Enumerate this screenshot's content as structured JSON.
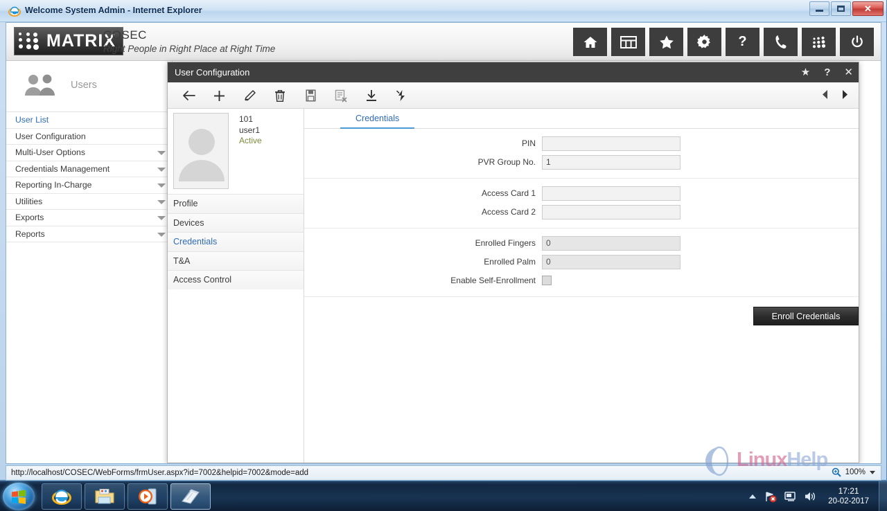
{
  "window": {
    "title": "Welcome System Admin - Internet Explorer",
    "favicon": "ie-icon",
    "minimize": "Minimize",
    "maximize": "Maximize",
    "close": "Close"
  },
  "app_header": {
    "brand": "MATRIX",
    "product": "COSEC",
    "tagline": "Right People in Right Place at Right Time",
    "icons": [
      {
        "name": "home-icon",
        "label": "Home"
      },
      {
        "name": "grid-icon",
        "label": "Dashboard"
      },
      {
        "name": "star-icon",
        "label": "Favorites"
      },
      {
        "name": "gear-icon",
        "label": "Settings"
      },
      {
        "name": "help-icon",
        "label": "Help"
      },
      {
        "name": "phone-icon",
        "label": "Support"
      },
      {
        "name": "dots-matrix-icon",
        "label": "Matrix"
      },
      {
        "name": "power-icon",
        "label": "Logout"
      }
    ]
  },
  "sidebar": {
    "section_title": "Users",
    "section_icon": "users-icon",
    "items": [
      {
        "label": "User List",
        "active": true,
        "expandable": false
      },
      {
        "label": "User Configuration",
        "active": false,
        "expandable": false
      },
      {
        "label": "Multi-User Options",
        "active": false,
        "expandable": true
      },
      {
        "label": "Credentials Management",
        "active": false,
        "expandable": true
      },
      {
        "label": "Reporting In-Charge",
        "active": false,
        "expandable": true
      },
      {
        "label": "Utilities",
        "active": false,
        "expandable": true
      },
      {
        "label": "Exports",
        "active": false,
        "expandable": true
      },
      {
        "label": "Reports",
        "active": false,
        "expandable": true
      }
    ]
  },
  "modal": {
    "title": "User Configuration",
    "title_icons": [
      {
        "name": "star-icon",
        "glyph": "★"
      },
      {
        "name": "help-icon",
        "glyph": "?"
      },
      {
        "name": "close-icon",
        "glyph": "✕"
      }
    ],
    "toolbar": [
      {
        "name": "back-icon",
        "label": "Back"
      },
      {
        "name": "add-icon",
        "label": "Add"
      },
      {
        "name": "edit-icon",
        "label": "Edit"
      },
      {
        "name": "delete-icon",
        "label": "Delete"
      },
      {
        "name": "save-icon",
        "label": "Save"
      },
      {
        "name": "cancel-form-icon",
        "label": "Cancel"
      },
      {
        "name": "import-icon",
        "label": "Import"
      },
      {
        "name": "refresh-icon",
        "label": "Refresh"
      }
    ],
    "pager": {
      "previous": "Previous record",
      "next": "Next record"
    },
    "user": {
      "id": "101",
      "name": "user1",
      "status": "Active",
      "status_color": "#7a8c3c",
      "avatar": "user-avatar-placeholder"
    },
    "sections": [
      {
        "label": "Profile",
        "active": false
      },
      {
        "label": "Devices",
        "active": false
      },
      {
        "label": "Credentials",
        "active": true
      },
      {
        "label": "T&A",
        "active": false
      },
      {
        "label": "Access Control",
        "active": false
      }
    ],
    "tabs": [
      {
        "label": "Credentials",
        "active": true
      }
    ],
    "form": {
      "groups": [
        {
          "fields": [
            {
              "label": "PIN",
              "value": "",
              "type": "text",
              "readonly": false
            },
            {
              "label": "PVR Group No.",
              "value": "1",
              "type": "text",
              "readonly": false
            }
          ]
        },
        {
          "fields": [
            {
              "label": "Access Card 1",
              "value": "",
              "type": "text",
              "readonly": false
            },
            {
              "label": "Access Card 2",
              "value": "",
              "type": "text",
              "readonly": false
            }
          ]
        },
        {
          "fields": [
            {
              "label": "Enrolled Fingers",
              "value": "0",
              "type": "text",
              "readonly": true
            },
            {
              "label": "Enrolled Palm",
              "value": "0",
              "type": "text",
              "readonly": true
            },
            {
              "label": "Enable Self-Enrollment",
              "value": "",
              "type": "checkbox",
              "checked": false
            }
          ]
        }
      ],
      "enroll_button": "Enroll Credentials"
    }
  },
  "statusbar": {
    "url": "http://localhost/COSEC/WebForms/frmUser.aspx?id=7002&helpid=7002&mode=add",
    "zoom_icon": "zoom-icon",
    "zoom_level": "100%"
  },
  "watermark": {
    "text_part1": "Linux",
    "text_part2": "Help",
    "color1": "#d2628c",
    "color2": "#8fa9d8"
  },
  "taskbar": {
    "start": "Start",
    "tasks": [
      {
        "name": "taskbar-internet-explorer",
        "label": "Internet Explorer"
      },
      {
        "name": "taskbar-file-explorer",
        "label": "Windows Explorer"
      },
      {
        "name": "taskbar-media-player",
        "label": "Windows Media Player"
      },
      {
        "name": "taskbar-active-window",
        "label": "Welcome System Admin - Internet Explorer"
      }
    ],
    "tray": [
      {
        "name": "network-error-icon",
        "label": "Network"
      },
      {
        "name": "action-center-icon",
        "label": "Action Center"
      },
      {
        "name": "volume-icon",
        "label": "Volume"
      }
    ],
    "clock": {
      "time": "17:21",
      "date": "20-02-2017"
    }
  }
}
